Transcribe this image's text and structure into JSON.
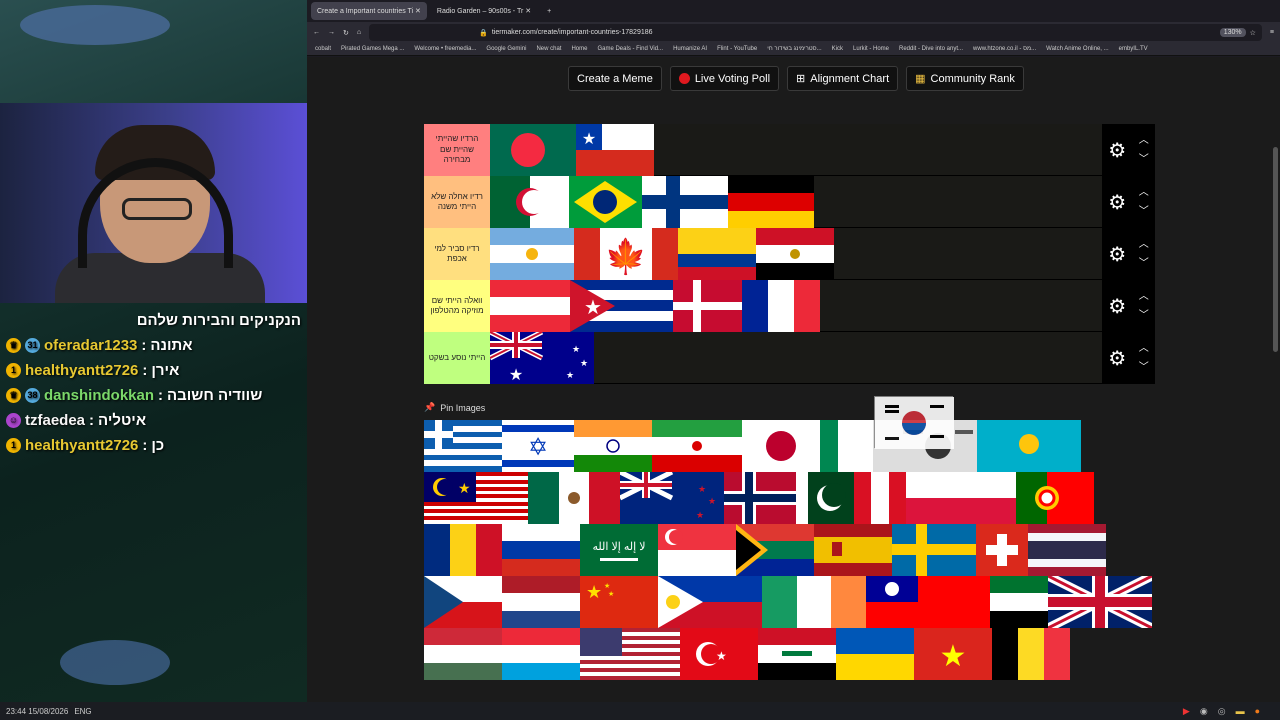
{
  "stream": {
    "chat_title": "הנקניקים והבירות שלהם",
    "messages": [
      {
        "user": "oferadar1233",
        "text": "אתונה",
        "badge": "31",
        "color": "gold"
      },
      {
        "user": "healthyantt2726",
        "text": "אירן",
        "badge": "1",
        "color": "gold"
      },
      {
        "user": "danshindokkan",
        "text": "שוודיה חשובה",
        "badge": "38",
        "color": "green"
      },
      {
        "user": "tzfaedea",
        "text": "איטליה",
        "badge": "",
        "color": "white"
      },
      {
        "user": "healthyantt2726",
        "text": "כן",
        "badge": "1",
        "color": "gold"
      }
    ]
  },
  "taskbar": {
    "time": "23:44",
    "date": "15/08/2026",
    "lang": "ENG"
  },
  "browser": {
    "tabs": [
      {
        "label": "Create a Important countries Ti ✕",
        "active": true
      },
      {
        "label": "Radio Garden – 90s00s - Tr ✕",
        "active": false
      }
    ],
    "new_tab": "+",
    "url": "tiermaker.com/create/important-countries-17829186",
    "zoom": "130%",
    "bookmarks": [
      "cobalt",
      "Pirated Games Mega ...",
      "Welcome • freemedia...",
      "Google Gemini",
      "New chat",
      "Home",
      "Game Deals - Find Vid...",
      "Humanize AI",
      "Flint - YouTube",
      "סטרימינג בשידור חי...",
      "Kick",
      "Lurkit - Home",
      "Reddit - Dive into anyt...",
      "www.htzone.co.il - מס...",
      "Watch Anime Online, ...",
      "embyIL.TV"
    ]
  },
  "toolbar": {
    "create_meme": "Create a Meme",
    "live_voting": "Live Voting Poll",
    "alignment": "Alignment Chart",
    "community": "Community Rank"
  },
  "tiers": [
    {
      "label": "הרדיו שהייתי שהיית שם מבחירה",
      "color": "#ff7f7f",
      "flags": [
        "bangladesh",
        "chile"
      ]
    },
    {
      "label": "רדיו אחלה שלא הייתי משנה",
      "color": "#ffbf7f",
      "flags": [
        "algeria",
        "brazil",
        "finland",
        "germany"
      ]
    },
    {
      "label": "רדיו סביר למי אכפת",
      "color": "#ffdf7f",
      "flags": [
        "argentina",
        "canada",
        "colombia",
        "egypt"
      ]
    },
    {
      "label": "וואלה הייתי שם מוזיקה מהטלפון",
      "color": "#ffff7f",
      "flags": [
        "austria",
        "cuba",
        "denmark",
        "france"
      ]
    },
    {
      "label": "הייתי נוסע בשקט",
      "color": "#bfff7f",
      "flags": [
        "australia"
      ]
    }
  ],
  "pin_images_label": "Pin Images",
  "pool_flags": [
    "greece",
    "israel",
    "india",
    "iran",
    "japan",
    "nigeria",
    "south-korea-shadow",
    "kazakhstan",
    "malaysia",
    "mexico",
    "new-zealand",
    "norway",
    "pakistan",
    "peru",
    "poland",
    "portugal",
    "romania",
    "russia",
    "saudi-arabia",
    "singapore",
    "south-africa",
    "spain",
    "sweden",
    "switzerland",
    "thailand",
    "czech",
    "netherlands",
    "china",
    "philippines",
    "ireland",
    "taiwan",
    "uae",
    "uk",
    "hungary",
    "luxembourg",
    "usa",
    "turkey",
    "iraq",
    "ukraine",
    "vietnam",
    "belgium"
  ],
  "dragging_flag": "south-korea"
}
